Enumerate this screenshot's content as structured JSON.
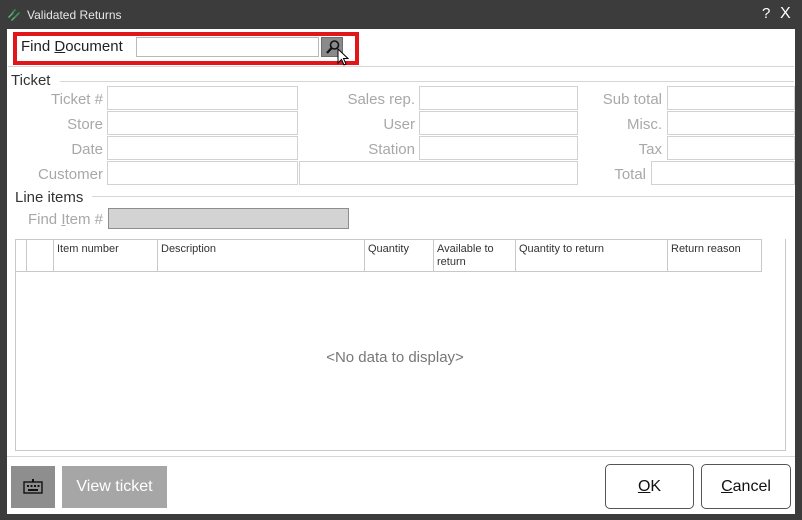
{
  "window": {
    "title": "Validated Returns",
    "help_label": "?",
    "close_label": "X"
  },
  "find_document": {
    "label_before": "Find ",
    "label_accel": "D",
    "label_after": "ocument",
    "value": ""
  },
  "ticket": {
    "section_label": "Ticket",
    "ticket_no_label": "Ticket #",
    "store_label": "Store",
    "date_label": "Date",
    "customer_label": "Customer",
    "sales_rep_label": "Sales rep.",
    "user_label": "User",
    "station_label": "Station",
    "subtotal_label": "Sub total",
    "misc_label": "Misc.",
    "tax_label": "Tax",
    "total_label": "Total"
  },
  "line_items": {
    "section_label": "Line items",
    "find_item_before": "Find ",
    "find_item_accel": "I",
    "find_item_after": "tem #",
    "columns": [
      "Item number",
      "Description",
      "Quantity",
      "Available to return",
      "Quantity to return",
      "Return reason"
    ],
    "empty_text": "<No data to display>"
  },
  "footer": {
    "view_ticket_label": "View ticket",
    "ok_accel": "O",
    "ok_rest": "K",
    "cancel_accel": "C",
    "cancel_rest": "ancel"
  },
  "colors": {
    "highlight": "#e0161b",
    "titlebar": "#3c3c3c",
    "accent": "#1e6e3a"
  },
  "icons": {
    "app": "app-logo-icon",
    "find": "magnifier-icon",
    "keyboard": "keyboard-icon",
    "pointer": "mouse-pointer-icon"
  }
}
